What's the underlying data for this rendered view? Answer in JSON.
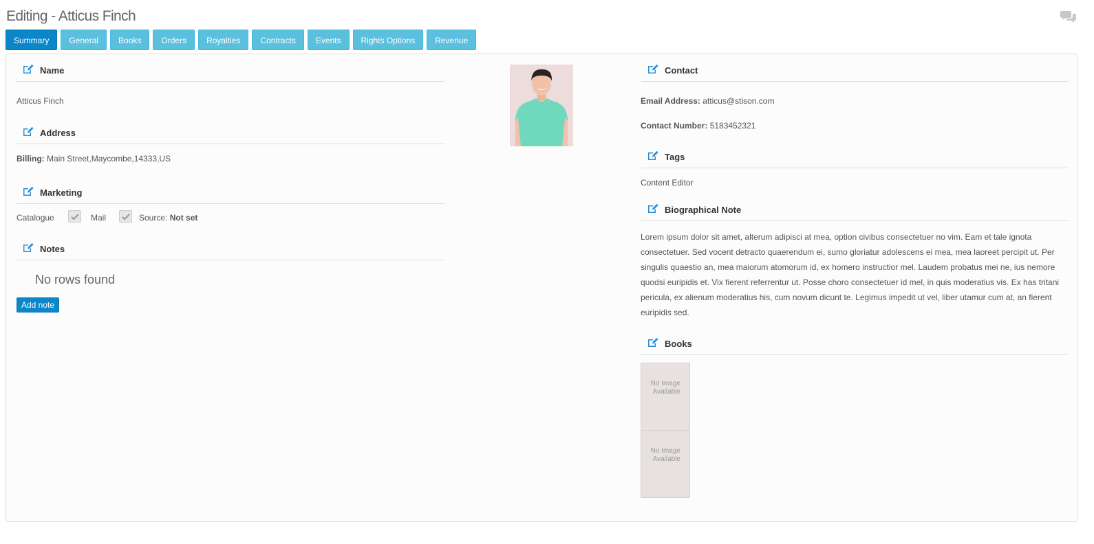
{
  "page": {
    "title": "Editing - Atticus Finch"
  },
  "tabs": [
    {
      "label": "Summary",
      "active": true
    },
    {
      "label": "General",
      "active": false
    },
    {
      "label": "Books",
      "active": false
    },
    {
      "label": "Orders",
      "active": false
    },
    {
      "label": "Royalties",
      "active": false
    },
    {
      "label": "Contracts",
      "active": false
    },
    {
      "label": "Events",
      "active": false
    },
    {
      "label": "Rights Options",
      "active": false
    },
    {
      "label": "Revenue",
      "active": false
    }
  ],
  "left": {
    "name": {
      "heading": "Name",
      "value": "Atticus Finch"
    },
    "address": {
      "heading": "Address",
      "billing_label": "Billing:",
      "billing_value": "Main Street,Maycombe,14333,US"
    },
    "marketing": {
      "heading": "Marketing",
      "catalogue_label": "Catalogue",
      "catalogue_checked": true,
      "mail_label": "Mail",
      "mail_checked": true,
      "source_label": "Source:",
      "source_value": "Not set"
    },
    "notes": {
      "heading": "Notes",
      "empty_text": "No rows found",
      "add_button": "Add note"
    }
  },
  "right": {
    "contact": {
      "heading": "Contact",
      "email_label": "Email Address:",
      "email_value": "atticus@stison.com",
      "phone_label": "Contact Number:",
      "phone_value": "5183452321"
    },
    "tags": {
      "heading": "Tags",
      "value": "Content Editor"
    },
    "bio": {
      "heading": "Biographical Note",
      "text": "Lorem ipsum dolor sit amet, alterum adipisci at mea, option civibus consectetuer no vim. Eam et tale ignota consectetuer. Sed vocent detracto quaerendum ei, sumo gloriatur adolescens ei mea, mea laoreet percipit ut. Per singulis quaestio an, mea maiorum atomorum id, ex homero instructior mel. Laudem probatus mei ne, ius nemore quodsi euripidis et. Vix fierent referrentur ut. Posse choro consectetuer id mel, in quis moderatius vis. Ex has tritani pericula, ex alienum moderatius his, cum novum dicunt te. Legimus impedit ut vel, liber utamur cum at, an fierent euripidis sed."
    },
    "books": {
      "heading": "Books",
      "items": [
        {
          "line1": "No Image",
          "line2": "Available"
        },
        {
          "line1": "No Image",
          "line2": "Available"
        }
      ]
    }
  },
  "colors": {
    "tab": "#5bc0de",
    "tab_active": "#0a86c9",
    "edit_icon": "#2a8fd6"
  },
  "icons": {
    "section_edit": "pencil-square-icon",
    "chat": "comments-icon"
  }
}
